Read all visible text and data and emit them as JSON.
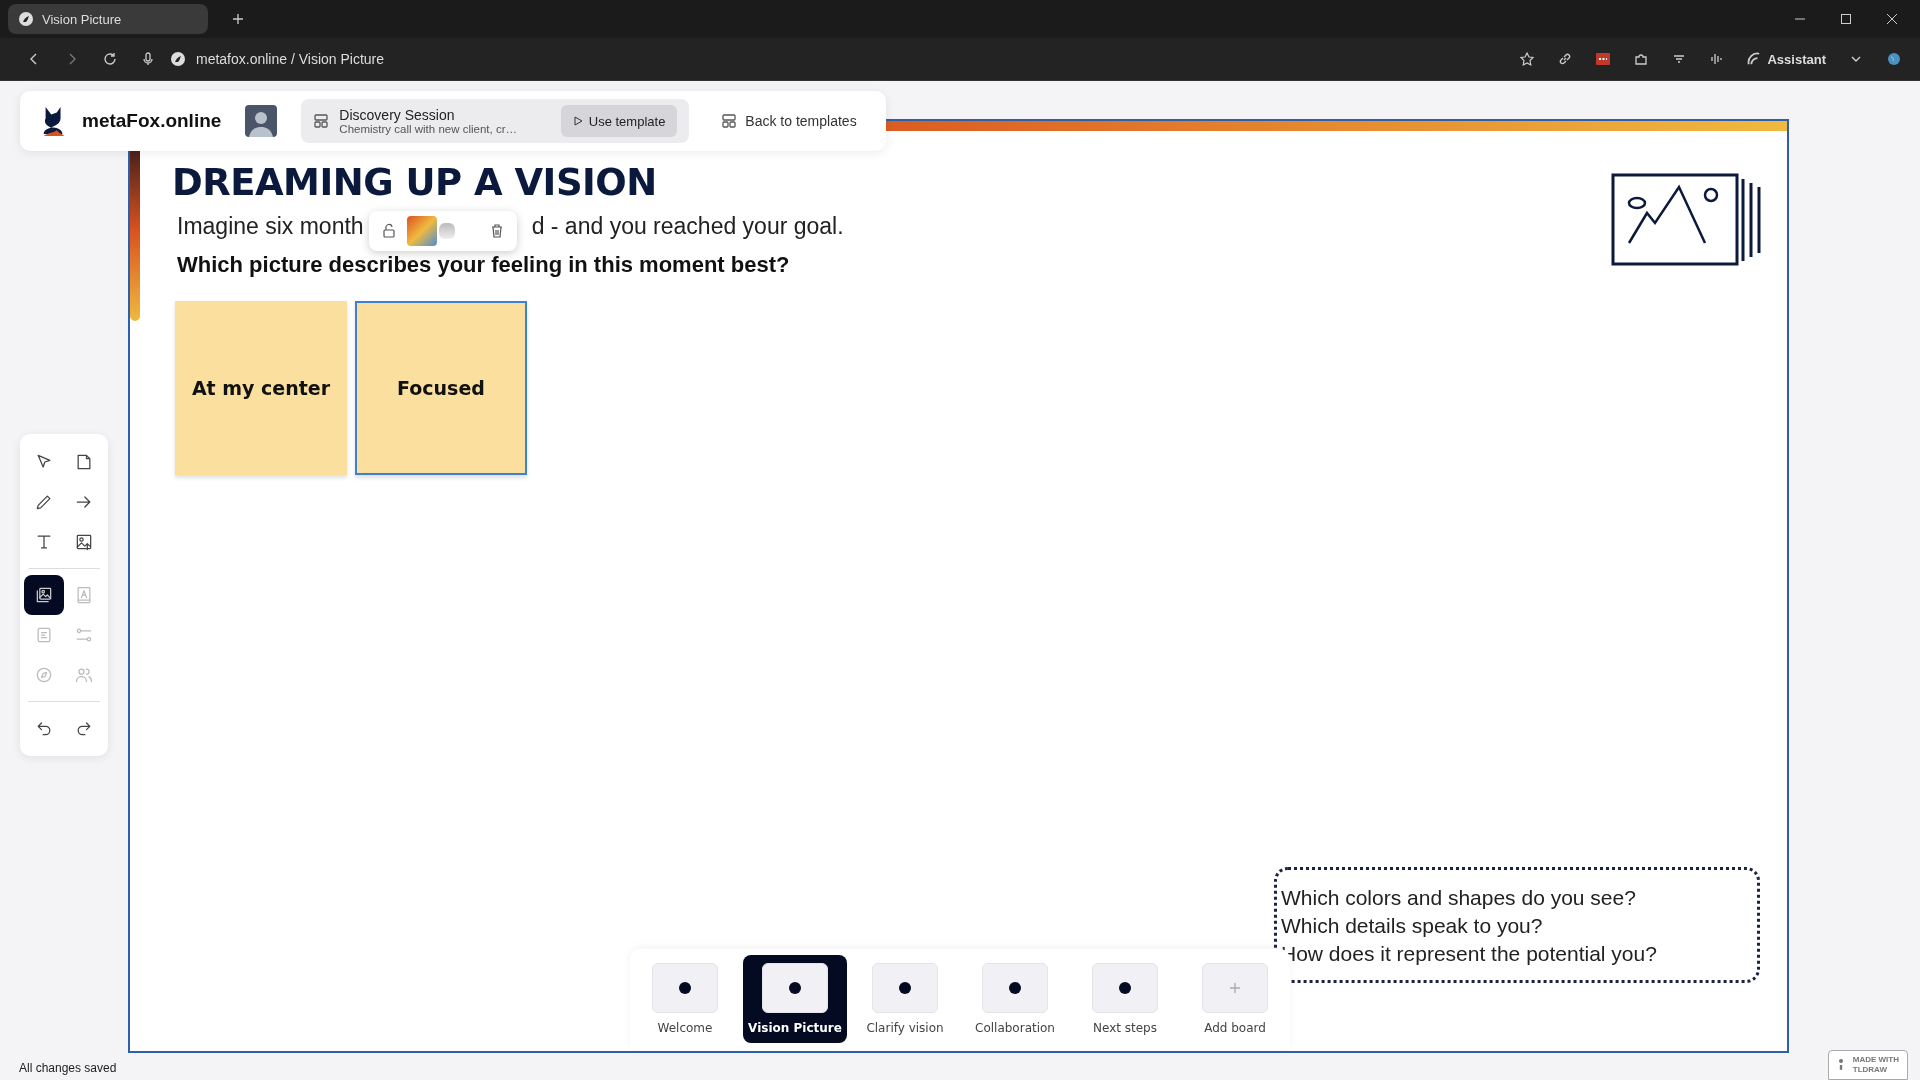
{
  "browser": {
    "tab_title": "Vision Picture",
    "address": "metafox.online / Vision Picture",
    "assistant": "Assistant"
  },
  "header": {
    "brand": "metaFox.online",
    "session_title": "Discovery Session",
    "session_subtitle": "Chemistry call with new client, cr…",
    "use_template": "Use template",
    "back": "Back to templates"
  },
  "tool_groups": [
    [
      {
        "kind": "select",
        "selected": false,
        "disabled": false
      },
      {
        "kind": "note",
        "selected": false,
        "disabled": false
      },
      {
        "kind": "pencil",
        "selected": false,
        "disabled": false
      },
      {
        "kind": "arrow",
        "selected": false,
        "disabled": false
      },
      {
        "kind": "text",
        "selected": false,
        "disabled": false
      },
      {
        "kind": "image-upload",
        "selected": false,
        "disabled": false
      }
    ],
    [
      {
        "kind": "gallery",
        "selected": true,
        "disabled": false
      },
      {
        "kind": "text-frame",
        "selected": false,
        "disabled": true
      },
      {
        "kind": "list",
        "selected": false,
        "disabled": true
      },
      {
        "kind": "sliders",
        "selected": false,
        "disabled": true
      },
      {
        "kind": "compass",
        "selected": false,
        "disabled": true
      },
      {
        "kind": "people",
        "selected": false,
        "disabled": true
      }
    ],
    [
      {
        "kind": "undo",
        "selected": false,
        "disabled": false
      },
      {
        "kind": "redo",
        "selected": false,
        "disabled": false
      }
    ]
  ],
  "canvas": {
    "title": "DREAMING UP A VISION",
    "intro_start": "Imagine six month",
    "intro_end": "d - and you reached your goal.",
    "question": "Which picture describes your feeling in this moment best?",
    "notes": [
      {
        "text": "At my center",
        "selected": false
      },
      {
        "text": "Focused",
        "selected": true
      }
    ],
    "prompts": [
      "Which colors and shapes do you see?",
      "Which details speak to you?",
      "How does it represent the potential you?"
    ]
  },
  "boards": [
    {
      "label": "Welcome",
      "kind": "board",
      "selected": false
    },
    {
      "label": "Vision Picture",
      "kind": "board",
      "selected": true
    },
    {
      "label": "Clarify vision",
      "kind": "board",
      "selected": false
    },
    {
      "label": "Collaboration",
      "kind": "board",
      "selected": false
    },
    {
      "label": "Next steps",
      "kind": "board",
      "selected": false
    },
    {
      "label": "Add board",
      "kind": "add",
      "selected": false
    }
  ],
  "status": "All changes saved",
  "badge": [
    "MADE WITH",
    "TLDRAW"
  ]
}
